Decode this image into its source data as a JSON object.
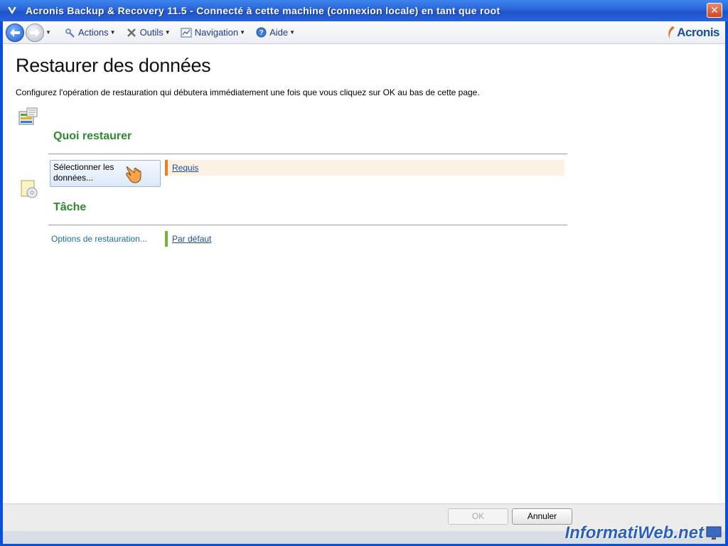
{
  "window": {
    "title": "Acronis Backup & Recovery 11.5 - Connecté à cette machine (connexion locale) en tant que root",
    "close_label": "✕"
  },
  "toolbar": {
    "menus": [
      {
        "label": "Actions",
        "icon": "actions-icon"
      },
      {
        "label": "Outils",
        "icon": "tools-icon"
      },
      {
        "label": "Navigation",
        "icon": "navigation-icon"
      },
      {
        "label": "Aide",
        "icon": "help-icon"
      }
    ],
    "logo_text": "Acronis"
  },
  "page": {
    "title": "Restaurer des données",
    "description": "Configurez l'opération de restauration qui débutera immédiatement une fois que vous cliquez sur OK au bas de cette page."
  },
  "sections": {
    "what": {
      "title": "Quoi restaurer",
      "button_label": "Sélectionner les données...",
      "status_link": "Requis",
      "status_color": "#f07f1a"
    },
    "task": {
      "title": "Tâche",
      "options_label": "Options de restauration...",
      "status_link": "Par défaut",
      "status_color": "#78b23c"
    }
  },
  "footer": {
    "ok_label": "OK",
    "cancel_label": "Annuler"
  },
  "watermark": "InformatiWeb.net"
}
